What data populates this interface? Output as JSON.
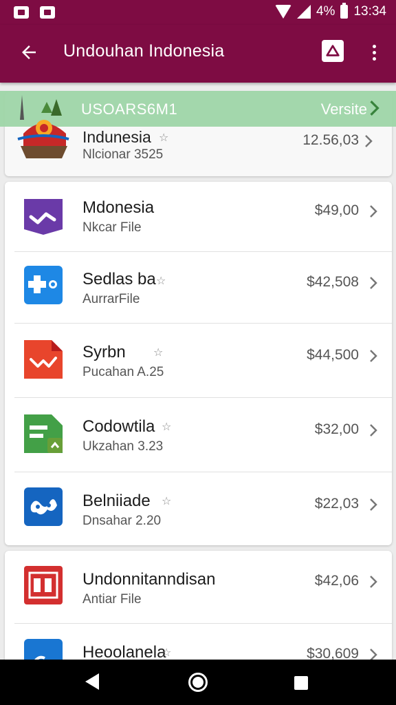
{
  "status_bar": {
    "battery": "4%",
    "time": "13:34"
  },
  "app_bar": {
    "title": "Undouhan Indonesia"
  },
  "banner": {
    "code": "USOARS6M1",
    "version_label": "Versite"
  },
  "header": {
    "title": "Indunesia",
    "subtitle": "Nlcionar 3525",
    "price": "12.56,03"
  },
  "items": [
    {
      "title": "Mdonesia",
      "subtitle": "Nkcar File",
      "price": "$49,00",
      "starred": false,
      "icon": "purple-check-icon",
      "color": "#6a3aa8"
    },
    {
      "title": "Sedlas ba",
      "subtitle": "AurrarFile",
      "price": "$42,508",
      "starred": true,
      "icon": "blue-share-icon",
      "color": "#1e88e5"
    },
    {
      "title": "Syrbn",
      "subtitle": "Pucahan A.25",
      "price": "$44,500",
      "starred": true,
      "icon": "red-chart-icon",
      "color": "#e8452c"
    },
    {
      "title": "Codowtila",
      "subtitle": "Ukzahan 3.23",
      "price": "$32,00",
      "starred": true,
      "icon": "green-sheet-icon",
      "color": "#43a047"
    },
    {
      "title": "Belniiade",
      "subtitle": "Dnsahar 2.20",
      "price": "$22,03",
      "starred": true,
      "icon": "blue-map-icon",
      "color": "#1565c0"
    },
    {
      "title": "Undonnitanndisan",
      "subtitle": "Antiar File",
      "price": "$42,06",
      "starred": false,
      "icon": "red-office-icon",
      "color": "#d32f2f"
    },
    {
      "title": "Heoolanela",
      "subtitle": "",
      "price": "$30,609",
      "starred": true,
      "icon": "blue-doc-icon",
      "color": "#1976d2"
    }
  ]
}
